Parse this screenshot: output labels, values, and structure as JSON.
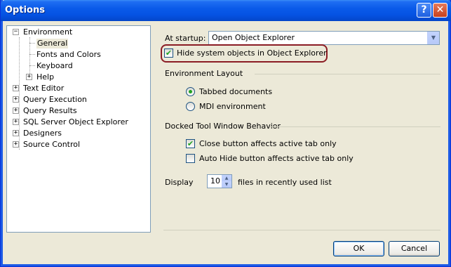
{
  "window": {
    "title": "Options",
    "help_label": "?",
    "close_label": "✕"
  },
  "tree": {
    "items": [
      {
        "label": "Environment",
        "toggle": "−"
      },
      {
        "label": "General"
      },
      {
        "label": "Fonts and Colors"
      },
      {
        "label": "Keyboard"
      },
      {
        "label": "Help",
        "toggle": "+"
      },
      {
        "label": "Text Editor",
        "toggle": "+"
      },
      {
        "label": "Query Execution",
        "toggle": "+"
      },
      {
        "label": "Query Results",
        "toggle": "+"
      },
      {
        "label": "SQL Server Object Explorer",
        "toggle": "+"
      },
      {
        "label": "Designers",
        "toggle": "+"
      },
      {
        "label": "Source Control",
        "toggle": "+"
      }
    ],
    "selected": "General"
  },
  "settings": {
    "startup_label": "At startup:",
    "startup_value": "Open Object Explorer",
    "hide_system_label": "Hide system objects in Object Explorer",
    "hide_system_checked": true,
    "env_layout_header": "Environment Layout",
    "tabbed_label": "Tabbed documents",
    "mdi_label": "MDI environment",
    "selected_layout": "Tabbed documents",
    "docked_header": "Docked Tool Window Behavior",
    "close_btn_label": "Close button affects active tab only",
    "close_btn_checked": true,
    "autohide_label": "Auto Hide button affects active tab only",
    "autohide_checked": false,
    "display_label": "Display",
    "display_value": "10",
    "display_suffix": "files in recently used list"
  },
  "buttons": {
    "ok": "OK",
    "cancel": "Cancel"
  },
  "colors": {
    "titlebar": "#0553e3",
    "highlight_ring": "#8b1c24",
    "check_mark": "#21a121"
  }
}
